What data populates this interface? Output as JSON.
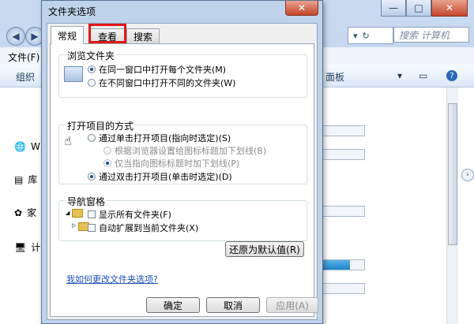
{
  "explorer": {
    "menu_file": "文件(F)",
    "toolbar_organize": "组织",
    "toolbar_panel": "面板",
    "search_placeholder": "搜索 计算机",
    "left_items": [
      "W",
      "库",
      "家",
      "计"
    ],
    "window_controls": {
      "min": "—",
      "max": "□",
      "close": "✕"
    },
    "drive_bars": [
      0.0,
      0.0,
      0.0,
      0.65,
      0.0
    ]
  },
  "dialog": {
    "title": "文件夹选项",
    "close": "✕",
    "tabs": [
      {
        "label": "常规",
        "active": true
      },
      {
        "label": "查看",
        "active": false,
        "highlighted": true
      },
      {
        "label": "搜索",
        "active": false
      }
    ],
    "browse": {
      "legend": "浏览文件夹",
      "options": [
        "在同一窗口中打开每个文件夹(M)",
        "在不同窗口中打开不同的文件夹(W)"
      ],
      "selected": 0
    },
    "click": {
      "legend": "打开项目的方式",
      "options": [
        "通过单击打开项目(指向时选定)(S)",
        "根据浏览器设置给图标标题加下划线(B)",
        "仅当指向图标标题时加下划线(P)",
        "通过双击打开项目(单击时选定)(D)"
      ],
      "selected": 3
    },
    "nav": {
      "legend": "导航窗格",
      "options": [
        "显示所有文件夹(F)",
        "自动扩展到当前文件夹(X)"
      ]
    },
    "restore_button": "还原为默认值(R)",
    "help_link": "我如何更改文件夹选项?",
    "ok": "确定",
    "cancel": "取消",
    "apply": "应用(A)"
  },
  "colors": {
    "highlight": "#e01818",
    "link": "#1a4fb8"
  }
}
